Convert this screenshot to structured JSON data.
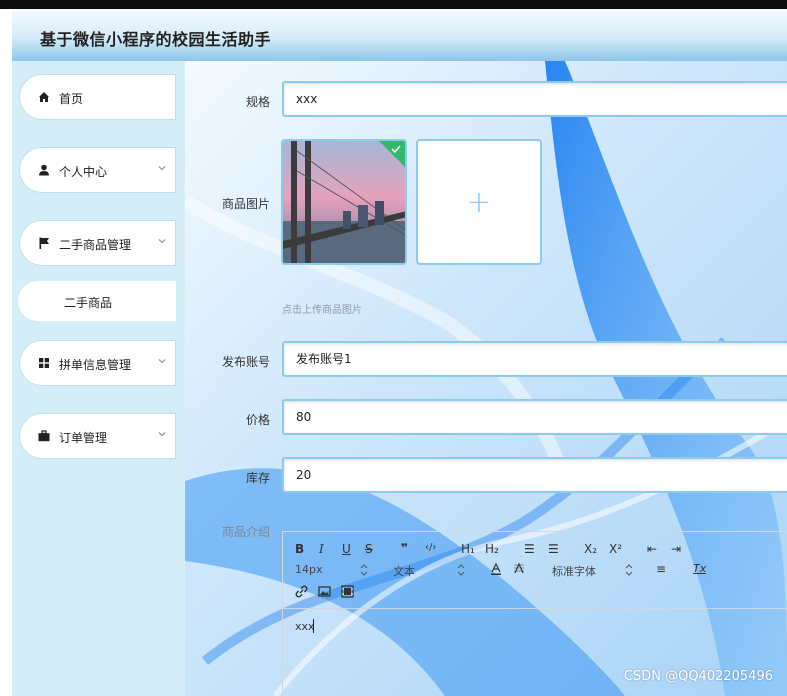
{
  "app": {
    "title": "基于微信小程序的校园生活助手"
  },
  "sidebar": {
    "items": [
      {
        "label": "首页",
        "icon": "home-icon"
      },
      {
        "label": "个人中心",
        "icon": "user-icon"
      },
      {
        "label": "二手商品管理",
        "icon": "flag-icon"
      },
      {
        "label": "拼单信息管理",
        "icon": "grid-icon"
      },
      {
        "label": "订单管理",
        "icon": "briefcase-icon"
      }
    ],
    "subitem": {
      "label": "二手商品"
    }
  },
  "form": {
    "spec": {
      "label": "规格",
      "value": "xxx"
    },
    "image": {
      "label": "商品图片",
      "hint": "点击上传商品图片",
      "add_symbol": "+"
    },
    "account": {
      "label": "发布账号",
      "value": "发布账号1"
    },
    "price": {
      "label": "价格",
      "value": "80"
    },
    "stock": {
      "label": "库存",
      "value": "20"
    },
    "intro": {
      "label": "商品介绍"
    }
  },
  "editor": {
    "toolbar": {
      "bold": "B",
      "italic": "I",
      "underline": "U",
      "strike": "S",
      "quote": "❞",
      "code": "‹/›",
      "h1": "H₁",
      "h2": "H₂",
      "ordered_list": "☰",
      "bullet_list": "☰",
      "subscript": "X₂",
      "superscript": "X²",
      "outdent": "⇤",
      "indent": "⇥",
      "font_size": "14px",
      "text_style": "文本",
      "font_family": "标准字体",
      "align": "≡",
      "clear_format": "Tx"
    },
    "content": "xxx"
  },
  "watermark": "CSDN @QQ402205496",
  "colors": {
    "accent": "#8ccbec",
    "sidebar_bg": "#d6eef7",
    "header_bg": "#d6ecf8"
  }
}
